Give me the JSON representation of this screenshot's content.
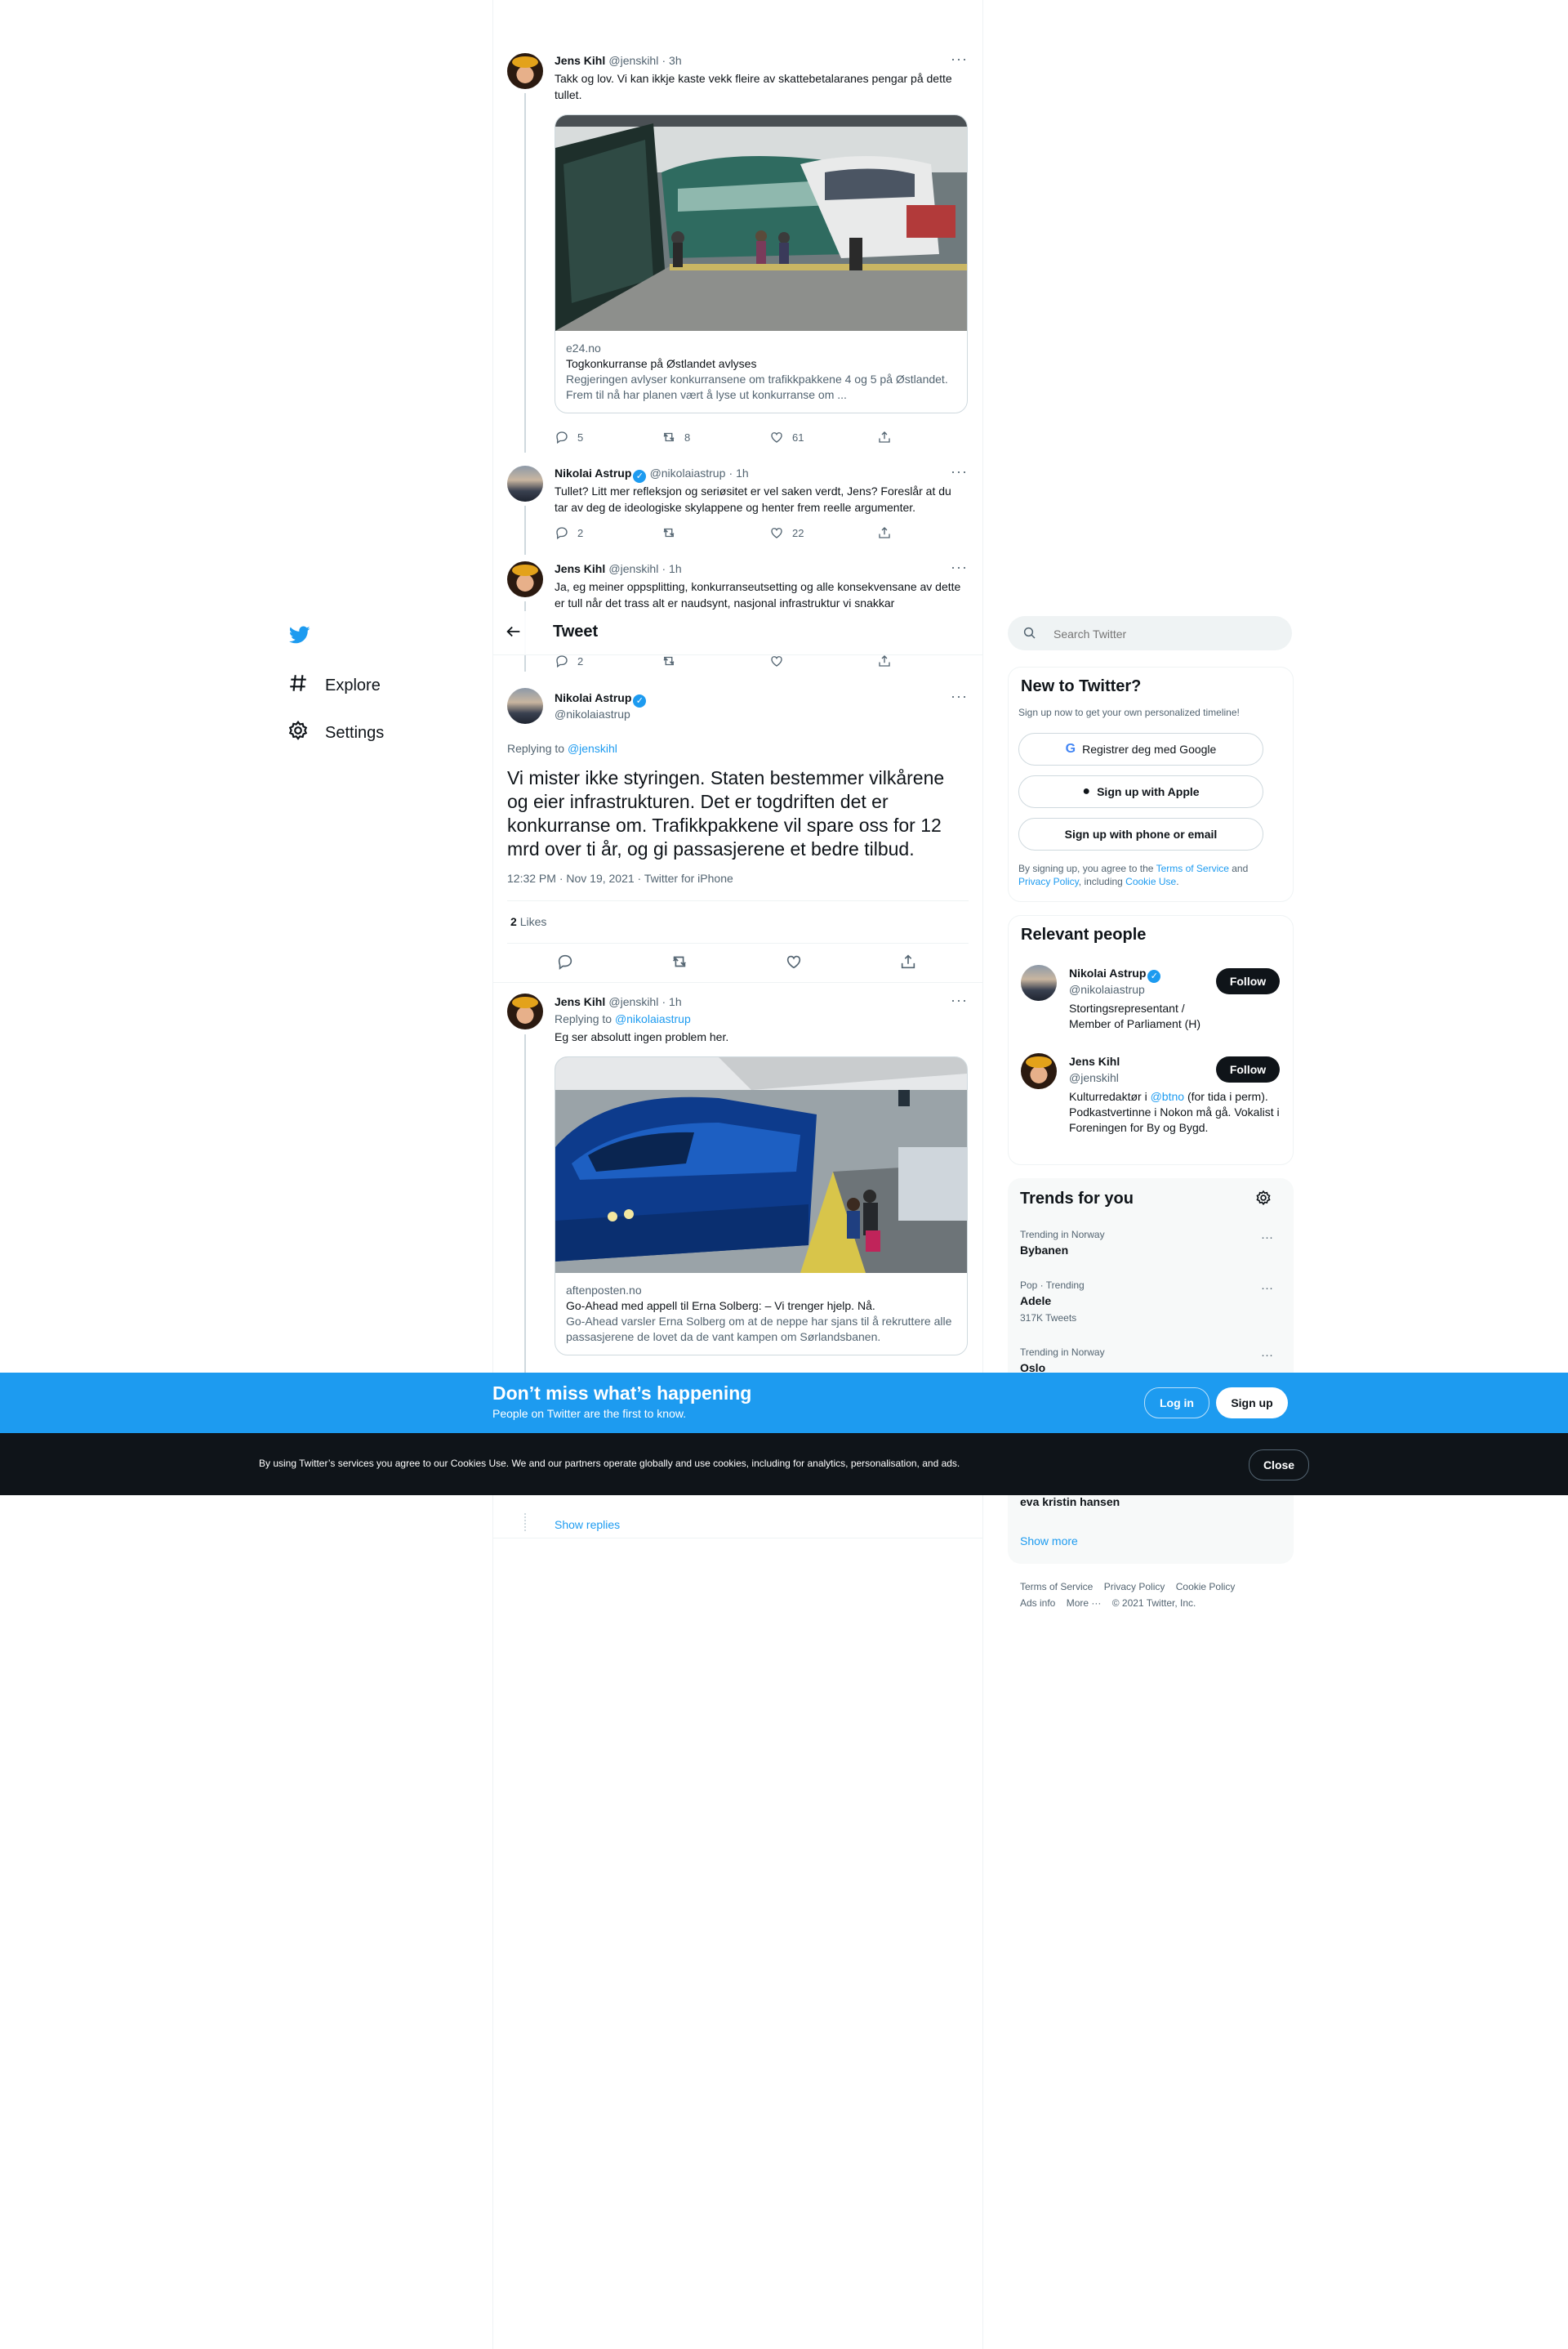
{
  "nav": {
    "explore": "Explore",
    "settings": "Settings"
  },
  "header": {
    "title": "Tweet"
  },
  "thread": [
    {
      "name": "Jens Kihl",
      "handle": "@jenskihl",
      "time": "· 3h",
      "text": "Takk og lov. Vi kan ikkje kaste vekk fleire av skattebetalaranes pengar på dette tullet.",
      "card": {
        "domain": "e24.no",
        "title": "Togkonkurranse på Østlandet avlyses",
        "desc": "Regjeringen avlyser konkurransene om trafikkpakkene 4 og 5 på Østlandet. Frem til nå har planen vært å lyse ut konkurranse om ..."
      },
      "replies": "5",
      "retweets": "8",
      "likes": "61"
    },
    {
      "name": "Nikolai Astrup",
      "handle": "@nikolaiastrup",
      "time": "· 1h",
      "text": "Tullet? Litt mer refleksjon og seriøsitet er vel saken verdt, Jens? Foreslår at du tar av deg de ideologiske skylappene og henter frem reelle argumenter.",
      "replies": "2",
      "retweets": "",
      "likes": "22"
    },
    {
      "name": "Jens Kihl",
      "handle": "@jenskihl",
      "time": "· 1h",
      "text": "Ja, eg meiner oppsplitting, konkurranseutsetting og alle konsekvensane av dette er tull når det trass alt er naudsynt, nasjonal infrastruktur vi snakkar",
      "replies": "2"
    }
  ],
  "main_tweet": {
    "name": "Nikolai Astrup",
    "handle": "@nikolaiastrup",
    "replying_prefix": "Replying to ",
    "replying_to": "@jenskihl",
    "text": "Vi mister ikke styringen. Staten bestemmer vilkårene og eier infrastrukturen. Det er togdriften det er konkurranse om. Trafikkpakkene vil spare oss for 12 mrd over ti år, og gi passasjerene et bedre tilbud.",
    "meta": "12:32 PM · Nov 19, 2021 · Twitter for iPhone",
    "likes_count": "2",
    "likes_label": "Likes"
  },
  "reply": {
    "name": "Jens Kihl",
    "handle": "@jenskihl",
    "time": "· 1h",
    "replying_prefix": "Replying to ",
    "replying_to": "@nikolaiastrup",
    "text": "Eg ser absolutt ingen problem her.",
    "card": {
      "domain": "aftenposten.no",
      "title": "Go-Ahead med appell til Erna Solberg: – Vi trenger hjelp. Nå.",
      "desc": "Go-Ahead varsler Erna Solberg om at de neppe har sjans til å rekruttere alle passasjerene de lovet da de vant kampen om Sørlandsbanen."
    },
    "show_replies": "Show replies"
  },
  "search": {
    "placeholder": "Search Twitter"
  },
  "new_to_twitter": {
    "title": "New to Twitter?",
    "subtitle": "Sign up now to get your own personalized timeline!",
    "google": "Registrer deg med Google",
    "apple": "Sign up with Apple",
    "phone": "Sign up with phone or email",
    "legal_1": "By signing up, you agree to the ",
    "tos": "Terms of Service",
    "legal_2": " and ",
    "privacy": "Privacy Policy",
    "legal_3": ", including ",
    "cookie": "Cookie Use",
    "legal_4": "."
  },
  "relevant_people": {
    "title": "Relevant people",
    "people": [
      {
        "name": "Nikolai Astrup",
        "handle": "@nikolaiastrup",
        "bio": "Stortingsrepresentant / Member of Parliament (H)",
        "follow": "Follow"
      },
      {
        "name": "Jens Kihl",
        "handle": "@jenskihl",
        "bio_1": "Kulturredaktør i ",
        "bio_link": "@btno",
        "bio_2": " (for tida i perm). Podkastvertinne i Nokon må gå. Vokalist i Foreningen for By og Bygd.",
        "follow": "Follow"
      }
    ]
  },
  "trends": {
    "title": "Trends for you",
    "items": [
      {
        "meta": "Trending in Norway",
        "name": "Bybanen",
        "count": ""
      },
      {
        "meta": "Pop · Trending",
        "name": "Adele",
        "count": "317K Tweets"
      },
      {
        "meta": "Trending in Norway",
        "name": "Oslo",
        "count": ""
      }
    ],
    "last_item": "eva kristin hansen",
    "show_more": "Show more"
  },
  "footer": {
    "tos": "Terms of Service",
    "privacy": "Privacy Policy",
    "cookie": "Cookie Policy",
    "ads": "Ads info",
    "more": "More ···",
    "copyright": "© 2021 Twitter, Inc."
  },
  "login_banner": {
    "title": "Don’t miss what’s happening",
    "subtitle": "People on Twitter are the first to know.",
    "login": "Log in",
    "signup": "Sign up"
  },
  "cookie_bar": {
    "text": "By using Twitter’s services you agree to our Cookies Use. We and our partners operate globally and use cookies, including for analytics, personalisation, and ads.",
    "close": "Close"
  },
  "colors": {
    "accent": "#1d9bf0",
    "text": "#0f1419",
    "secondary": "#536471",
    "dark_bar": "#0f1419"
  }
}
